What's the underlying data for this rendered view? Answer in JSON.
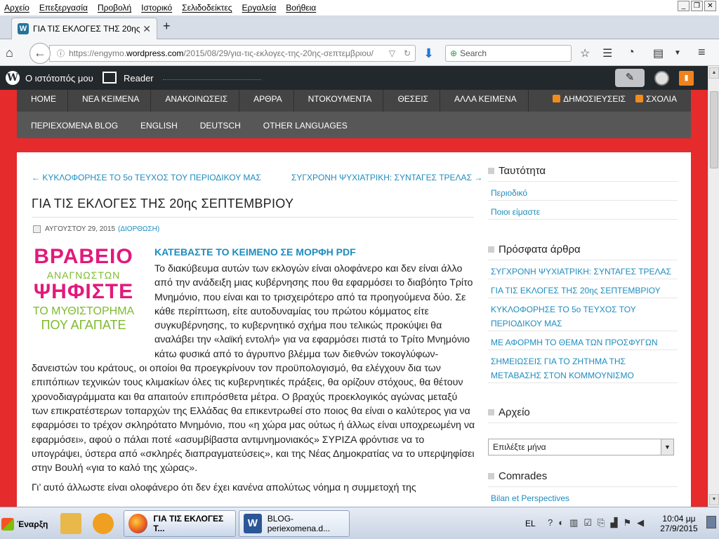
{
  "menubar": {
    "items": [
      "Αρχείο",
      "Επεξεργασία",
      "Προβολή",
      "Ιστορικό",
      "Σελιδοδείκτες",
      "Εργαλεία",
      "Βοήθεια"
    ]
  },
  "window_controls": {
    "minimize": "_",
    "restore": "❐",
    "close": "✕"
  },
  "tab": {
    "title": "ΓΙΑ ΤΙΣ ΕΚΛΟΓΕΣ ΤΗΣ 20ης Σ...",
    "favicon": "W",
    "close": "✕",
    "new_tab": "+"
  },
  "navbar": {
    "url_prefix": "https://engymo.",
    "url_domain": "wordpress.com",
    "url_path": "/2015/08/29/για-τις-εκλογες-της-20ης-σεπτεμβριου/",
    "search_placeholder": "Search"
  },
  "wpbar": {
    "site_label": "Ο ιστότοπός μου",
    "reader_label": "Reader",
    "logo": "W"
  },
  "site_nav": {
    "primary": [
      "HOME",
      "ΝΕΑ ΚΕΙΜΕΝΑ",
      "ΑΝΑΚΟΙΝΩΣΕΙΣ",
      "ΑΡΘΡΑ",
      "ΝΤΟΚΟΥΜΕΝΤΑ",
      "ΘΕΣΕΙΣ",
      "ΑΛΛΑ ΚΕΙΜΕΝΑ"
    ],
    "feeds": [
      "ΔΗΜΟΣΙΕΥΣΕΙΣ",
      "ΣΧΟΛΙΑ"
    ],
    "secondary": [
      "ΠΕΡΙΕΧΟΜΕΝΑ BLOG",
      "ENGLISH",
      "DEUTSCH",
      "OTHER LANGUAGES"
    ]
  },
  "post": {
    "prev_link": "← ΚΥΚΛΟΦΟΡΗΣΕ ΤΟ 5ο ΤΕΥΧΟΣ ΤΟΥ ΠΕΡΙΟΔΙΚΟΥ ΜΑΣ",
    "next_link": "ΣΥΓΧΡΟΝΗ ΨΥΧΙΑΤΡΙΚΗ: ΣΥΝΤΑΓΕΣ ΤΡΕΛΑΣ →",
    "title": "ΓΙΑ ΤΙΣ ΕΚΛΟΓΕΣ ΤΗΣ 20ης ΣΕΠΤΕΜΒΡΙΟΥ",
    "date": "ΑΥΓΟΥΣΤΟΥ 29, 2015",
    "edit_link": "(ΔΙΟΡΘΩΣΗ)",
    "image_lines": [
      "ΒΡΑΒΕΙΟ",
      "ΑΝΑΓΝΩΣΤΩΝ",
      "ΨΗΦΙΣΤΕ",
      "ΤΟ ΜΥΘΙΣΤΟΡΗΜΑ",
      "ΠΟΥ ΑΓΑΠΑΤΕ"
    ],
    "download_link": "ΚΑΤΕΒΑΣΤΕ ΤΟ ΚΕΙΜΕΝΟ ΣΕ ΜΟΡΦΗ PDF",
    "paragraph1": "Το διακύβευμα αυτών των εκλογών είναι ολοφάνερο και δεν είναι άλλο από την ανάδειξη μιας κυβέρνησης που θα εφαρμόσει το διαβόητο Τρίτο Μνημόνιο, που είναι και το τρισχειρότερο από τα προηγούμενα δύο. Σε κάθε περίπτωση, είτε αυτοδυναμίας του πρώτου κόμματος είτε συγκυβέρνησης, το κυβερνητικό σχήμα που τελικώς προκύψει θα αναλάβει την «λαϊκή εντολή» για να εφαρμόσει πιστά το Τρίτο Μνημόνιο κάτω φυσικά από το άγρυπνο βλέμμα των διεθνών τοκογλύφων-δανειστών του κράτους, οι οποίοι θα προεγκρίνουν τον προϋπολογισμό, θα ελέγχουν δια των επιπόπιων τεχνικών τους κλιμακίων όλες τις κυβερνητικές πράξεις, θα ορίζουν στόχους, θα θέτουν χρονοδιαγράμματα και θα απαιτούν επιπρόσθετα μέτρα. Ο βραχύς προεκλογικός αγώνας μεταξύ των επικρατέστερων τοπαρχών της Ελλάδας θα επικεντρωθεί στο ποιος θα είναι ο καλύτερος για να εφαρμόσει το τρέχον σκληρότατο Μνημόνιο, που «η χώρα μας ούτως ή άλλως είναι υποχρεωμένη να εφαρμόσει», αφού ο πάλαι ποτέ «ασυμβίβαστα αντιμνημονιακός» ΣΥΡΙΖΑ φρόντισε να το υπογράψει, ύστερα από «σκληρές διαπραγματεύσεις», και της Νέας Δημοκρατίας να το υπερψηφίσει στην Βουλή «για το καλό της χώρας».",
    "paragraph2": "Γι’ αυτό άλλωστε είναι ολοφάνερο ότι δεν έχει κανένα απολύτως νόημα η συμμετοχή της"
  },
  "sidebar": {
    "identity_title": "Ταυτότητα",
    "identity_links": [
      "Περιοδικό",
      "Ποιοι είμαστε"
    ],
    "recent_title": "Πρόσφατα άρθρα",
    "recent_links": [
      "ΣΥΓΧΡΟΝΗ ΨΥΧΙΑΤΡΙΚΗ: ΣΥΝΤΑΓΕΣ ΤΡΕΛΑΣ",
      "ΓΙΑ ΤΙΣ ΕΚΛΟΓΕΣ ΤΗΣ 20ης ΣΕΠΤΕΜΒΡΙΟΥ",
      "ΚΥΚΛΟΦΟΡΗΣΕ ΤΟ 5ο ΤΕΥΧΟΣ ΤΟΥ ΠΕΡΙΟΔΙΚΟΥ ΜΑΣ",
      "ΜΕ ΑΦΟΡΜΗ ΤΟ ΘΕΜΑ ΤΩΝ ΠΡΟΣΦΥΓΩΝ",
      "ΣΗΜΕΙΩΣΕΙΣ ΓΙΑ ΤΟ ΖΗΤΗΜΑ ΤΗΣ ΜΕΤΑΒΑΣΗΣ ΣΤΟΝ ΚΟΜΜΟΥΝΙΣΜΟ"
    ],
    "archive_title": "Αρχείο",
    "archive_select": "Επιλέξτε μήνα",
    "comrades_title": "Comrades",
    "comrades_links": [
      "Bilan et Perspectives"
    ]
  },
  "taskbar": {
    "start_label": "Έναρξη",
    "tasks": [
      "ΓΙΑ ΤΙΣ ΕΚΛΟΓΕΣ Τ...",
      "BLOG-periexomena.d..."
    ],
    "language": "EL",
    "time": "10:04 μμ",
    "date": "27/9/2015"
  },
  "colors": {
    "page_bg": "#e52b2b",
    "nav_primary": "#444444",
    "nav_secondary": "#575757",
    "link": "#1e8cbe",
    "wpbar": "#23282d"
  }
}
